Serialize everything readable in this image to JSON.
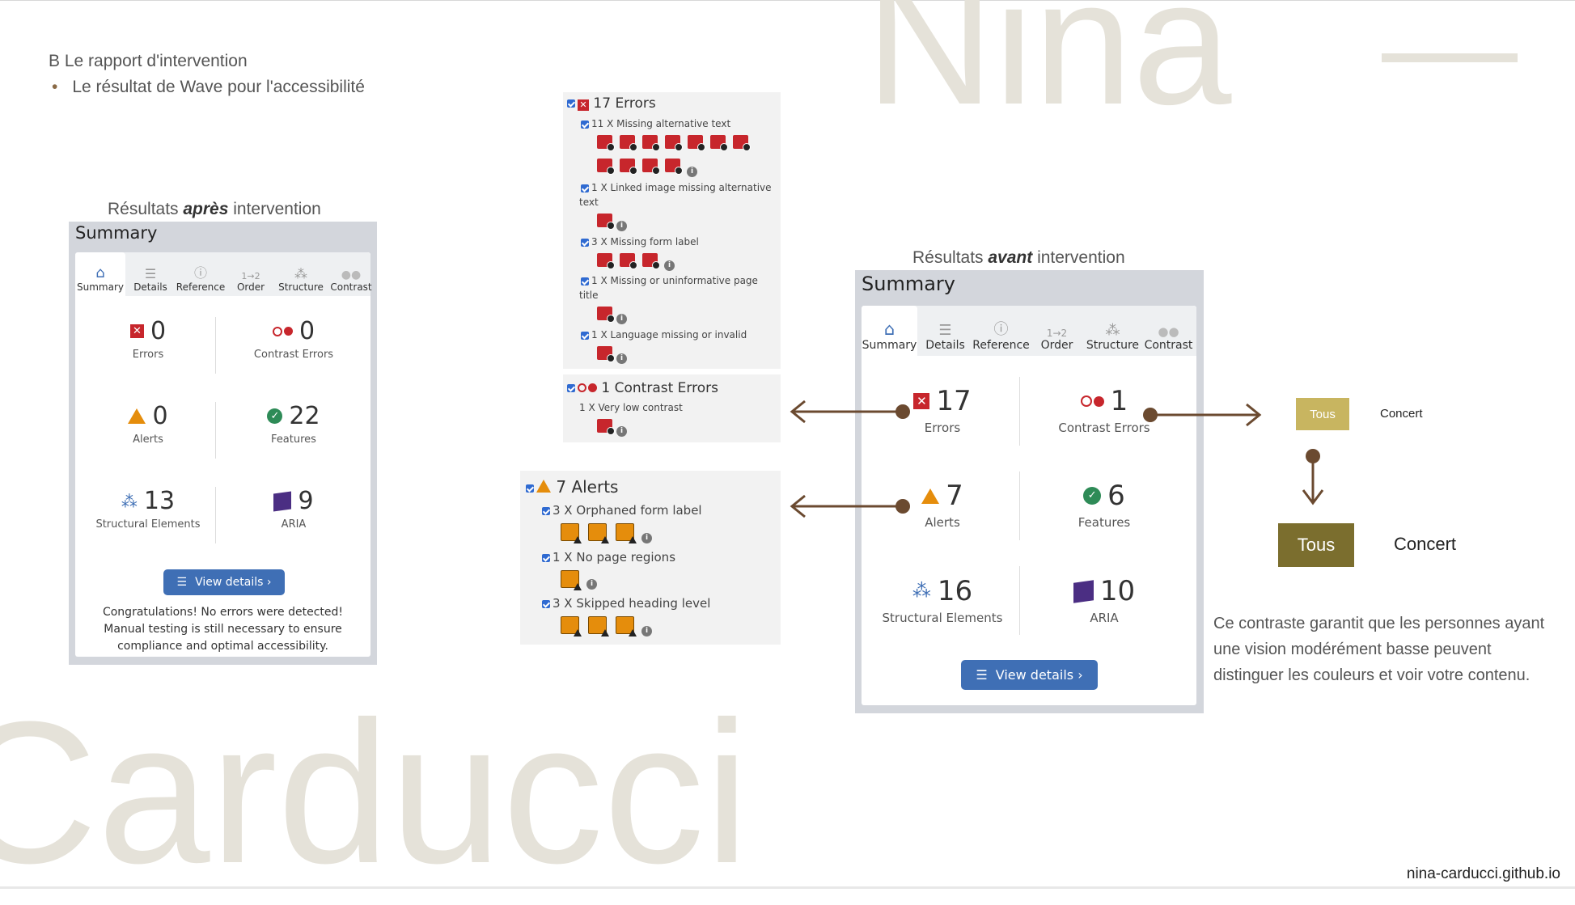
{
  "background": {
    "word1": "Nina",
    "dash": "—",
    "word2": "Carducci"
  },
  "slide": {
    "title": "B Le rapport d'intervention",
    "bullet": "Le résultat de Wave pour l'accessibilité"
  },
  "after": {
    "caption_pre": "Résultats ",
    "caption_em": "après",
    "caption_post": " intervention",
    "heading": "Summary",
    "tabs": [
      "Summary",
      "Details",
      "Reference",
      "Order",
      "Structure",
      "Contrast"
    ],
    "metrics": {
      "errors": {
        "value": "0",
        "label": "Errors"
      },
      "contrast": {
        "value": "0",
        "label": "Contrast Errors"
      },
      "alerts": {
        "value": "0",
        "label": "Alerts"
      },
      "features": {
        "value": "22",
        "label": "Features"
      },
      "structural": {
        "value": "13",
        "label": "Structural Elements"
      },
      "aria": {
        "value": "9",
        "label": "ARIA"
      }
    },
    "button": "View details ›",
    "congrats": "Congratulations! No errors were detected! Manual testing is still necessary to ensure compliance and optimal accessibility."
  },
  "before": {
    "caption_pre": "Résultats ",
    "caption_em": "avant",
    "caption_post": " intervention",
    "heading": "Summary",
    "tabs": [
      "Summary",
      "Details",
      "Reference",
      "Order",
      "Structure",
      "Contrast"
    ],
    "metrics": {
      "errors": {
        "value": "17",
        "label": "Errors"
      },
      "contrast": {
        "value": "1",
        "label": "Contrast Errors"
      },
      "alerts": {
        "value": "7",
        "label": "Alerts"
      },
      "features": {
        "value": "6",
        "label": "Features"
      },
      "structural": {
        "value": "16",
        "label": "Structural Elements"
      },
      "aria": {
        "value": "10",
        "label": "ARIA"
      }
    },
    "button": "View details ›"
  },
  "errors_box": {
    "header": "17 Errors",
    "items": [
      "11 X Missing alternative text",
      "1 X Linked image missing alternative",
      "text",
      "3 X Missing form label",
      "1 X Missing or uninformative page",
      "title",
      "1 X Language missing or invalid"
    ]
  },
  "contrast_box": {
    "header": "1 Contrast Errors",
    "item": "1 X Very low contrast"
  },
  "alerts_box": {
    "header": "7 Alerts",
    "items": [
      "3 X Orphaned form label",
      "1 X No page regions",
      "3 X Skipped heading level"
    ]
  },
  "contrast_demo": {
    "small_button": "Tous",
    "small_label": "Concert",
    "big_button": "Tous",
    "big_label": "Concert",
    "before_bg": "#c8b560",
    "after_bg": "#7b6e2e"
  },
  "description": "Ce contraste garantit que les personnes ayant une vision modérément basse peuvent distinguer les couleurs et voir votre contenu.",
  "footer": "nina-carducci.github.io",
  "colors": {
    "accent": "#6b4a30",
    "wave_blue": "#3f6fb5",
    "error_red": "#c7262c",
    "alert_orange": "#e58d0c"
  }
}
